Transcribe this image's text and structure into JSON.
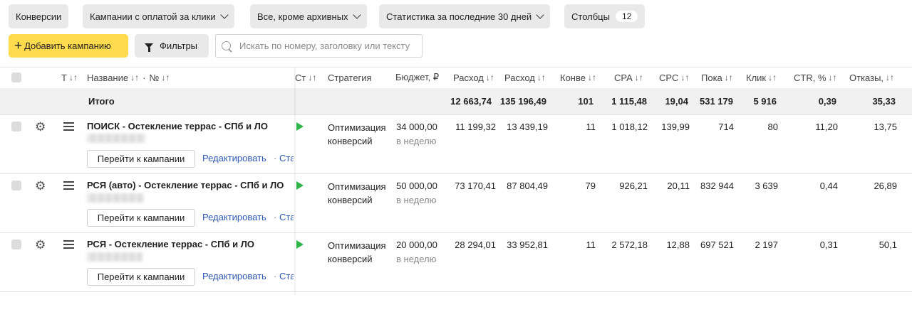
{
  "toolbar": {
    "conversions": "Конверсии",
    "campaign_type": "Кампании с оплатой за клики",
    "archive_filter": "Все, кроме архивных",
    "stats_period": "Статистика за последние 30 дней",
    "columns_label": "Столбцы",
    "columns_count": "12",
    "add_campaign": "Добавить кампанию",
    "filters": "Фильтры",
    "search_placeholder": "Искать по номеру, заголовку или тексту"
  },
  "headers": {
    "type": "Т",
    "name": "Название",
    "sort": "↓↑",
    "dot": "·",
    "number": "№",
    "status": "Ст",
    "strategy": "Стратегия",
    "budget": "Бюджет, ₽",
    "spend1": "Расход",
    "spend2": "Расход",
    "conversions": "Конве",
    "cpa": "CPA",
    "cpc": "CPC",
    "impressions": "Пока",
    "clicks": "Клик",
    "ctr": "CTR, %",
    "bounces": "Отказы,"
  },
  "totals": {
    "label": "Итого",
    "spend1": "12 663,74",
    "spend2": "135 196,49",
    "conversions": "101",
    "cpa": "1 115,48",
    "cpc": "19,04",
    "impressions": "531 179",
    "clicks": "5 916",
    "ctr": "0,39",
    "bounces": "35,33"
  },
  "row_actions": {
    "goto": "Перейти к кампании",
    "edit": "Редактировать",
    "stats": "Ста",
    "dot": "·"
  },
  "rows": [
    {
      "name": "ПОИСК - Остекление террас - СПб и ЛО",
      "strategy_line1": "Оптимизация",
      "strategy_line2": "конверсий",
      "budget": "34 000,00",
      "budget_period": "в неделю",
      "spend1": "11 199,32",
      "spend2": "13 439,19",
      "conversions": "11",
      "cpa": "1 018,12",
      "cpc": "139,99",
      "impressions": "714",
      "clicks": "80",
      "ctr": "11,20",
      "bounces": "13,75"
    },
    {
      "name": "РСЯ (авто) - Остекление террас - СПб и ЛО",
      "strategy_line1": "Оптимизация",
      "strategy_line2": "конверсий",
      "budget": "50 000,00",
      "budget_period": "в неделю",
      "spend1": "73 170,41",
      "spend2": "87 804,49",
      "conversions": "79",
      "cpa": "926,21",
      "cpc": "20,11",
      "impressions": "832 944",
      "clicks": "3 639",
      "ctr": "0,44",
      "bounces": "26,89"
    },
    {
      "name": "РСЯ - Остекление террас - СПб и ЛО",
      "strategy_line1": "Оптимизация",
      "strategy_line2": "конверсий",
      "budget": "20 000,00",
      "budget_period": "в неделю",
      "spend1": "28 294,01",
      "spend2": "33 952,81",
      "conversions": "11",
      "cpa": "2 572,18",
      "cpc": "12,88",
      "impressions": "697 521",
      "clicks": "2 197",
      "ctr": "0,31",
      "bounces": "50,1"
    }
  ],
  "colors": {
    "accent_yellow": "#ffdb4d",
    "link_blue": "#2f58b3",
    "status_green": "#2fb449"
  }
}
